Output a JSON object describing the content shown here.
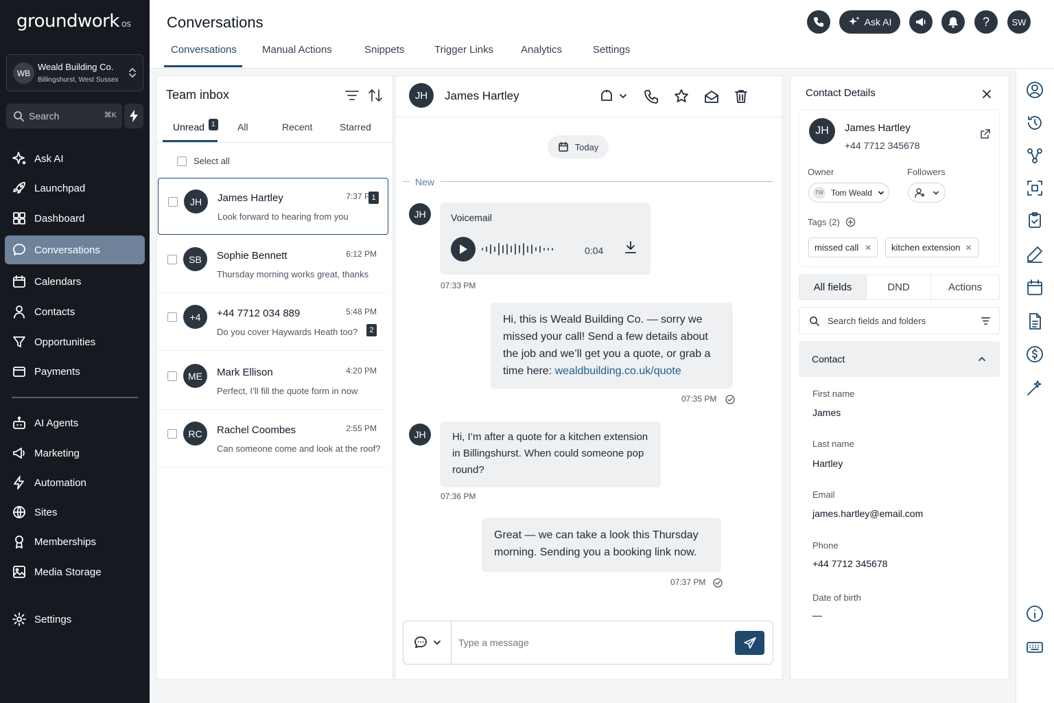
{
  "sidebar": {
    "logo": "groundwork",
    "logo_suffix": "os",
    "location": {
      "initials": "WB",
      "name": "Weald Building Co.",
      "address": "Billingshurst, West Sussex"
    },
    "search": {
      "placeholder": "Search",
      "shortcut": "⌘K"
    },
    "nav": [
      {
        "label": "Ask AI",
        "icon": "sparkle-icon"
      },
      {
        "label": "Launchpad",
        "icon": "rocket-icon"
      },
      {
        "label": "Dashboard",
        "icon": "grid-icon"
      },
      {
        "label": "Conversations",
        "icon": "chat-bubble-icon",
        "active": true
      },
      {
        "label": "Calendars",
        "icon": "calendar-icon"
      },
      {
        "label": "Contacts",
        "icon": "person-icon"
      },
      {
        "label": "Opportunities",
        "icon": "funnel-icon"
      },
      {
        "label": "Payments",
        "icon": "card-icon"
      }
    ],
    "nav2": [
      {
        "label": "AI Agents",
        "icon": "robot-icon"
      },
      {
        "label": "Marketing",
        "icon": "megaphone-icon"
      },
      {
        "label": "Automation",
        "icon": "bolt-icon"
      },
      {
        "label": "Sites",
        "icon": "globe-icon"
      },
      {
        "label": "Memberships",
        "icon": "medal-icon"
      },
      {
        "label": "Media Storage",
        "icon": "image-icon"
      }
    ],
    "settings": "Settings"
  },
  "header": {
    "title": "Conversations",
    "tabs": [
      "Conversations",
      "Manual Actions",
      "Snippets",
      "Trigger Links",
      "Analytics",
      "Settings"
    ],
    "active_tab": "Conversations",
    "ask_ai": "Ask AI",
    "user_initials": "SW"
  },
  "inbox": {
    "title": "Team inbox",
    "filters": [
      "Unread",
      "All",
      "Recent",
      "Starred"
    ],
    "unread_count": "1",
    "select_all": "Select all",
    "conversations": [
      {
        "initials": "JH",
        "name": "James Hartley",
        "time": "7:37 PM",
        "preview": "Look forward to hearing from you",
        "unread": "1"
      },
      {
        "initials": "SB",
        "name": "Sophie Bennett",
        "time": "6:12 PM",
        "preview": "Thursday morning works great, thanks",
        "unread": ""
      },
      {
        "initials": "+4",
        "name": "+44 7712 034 889",
        "time": "5:48 PM",
        "preview": "Do you cover Haywards Heath too?",
        "unread": "2"
      },
      {
        "initials": "ME",
        "name": "Mark Ellison",
        "time": "4:20 PM",
        "preview": "Perfect, I’ll fill the quote form in now",
        "unread": ""
      },
      {
        "initials": "RC",
        "name": "Rachel Coombes",
        "time": "2:55 PM",
        "preview": "Can someone come and look at the roof?",
        "unread": ""
      }
    ]
  },
  "chat": {
    "contact_initials": "JH",
    "contact_name": "James Hartley",
    "date_chip": "Today",
    "new_label": "New",
    "voicemail": {
      "label": "Voicemail",
      "duration": "0:04",
      "time": "07:33 PM"
    },
    "msg1": {
      "text_before": "Hi, this is Weald Building Co. — sorry we missed your call! Send a few details about the job and we’ll get you a quote, or grab a time here: ",
      "link": "wealdbuilding.co.uk/quote",
      "time": "07:35 PM"
    },
    "msg2": {
      "text": "Hi, I’m after a quote for a kitchen extension in Billingshurst. When could someone pop round?",
      "time": "07:36 PM"
    },
    "msg3": {
      "text": "Great — we can take a look this Thursday morning. Sending you a booking link now.",
      "time": "07:37 PM"
    },
    "composer_placeholder": "Type a message"
  },
  "contact": {
    "panel_title": "Contact Details",
    "initials": "JH",
    "name": "James Hartley",
    "phone": "+44 7712 345678",
    "owner_label": "Owner",
    "owner_initials": "TW",
    "owner_name": "Tom Weald",
    "followers_label": "Followers",
    "tags_label": "Tags (2)",
    "tags": [
      "missed call",
      "kitchen extension"
    ],
    "tabs": [
      "All fields",
      "DND",
      "Actions"
    ],
    "search_placeholder": "Search fields and folders",
    "section": "Contact",
    "fields": [
      {
        "label": "First name",
        "value": "James"
      },
      {
        "label": "Last name",
        "value": "Hartley"
      },
      {
        "label": "Email",
        "value": "james.hartley@email.com"
      },
      {
        "label": "Phone",
        "value": "+44 7712 345678"
      },
      {
        "label": "Date of birth",
        "value": "—"
      }
    ]
  },
  "colors": {
    "sidebar_bg": "#161a20",
    "accent": "#1f4a6e",
    "active_nav": "#6e839a",
    "bubble": "#eef0f2",
    "link": "#1f5f8b"
  }
}
